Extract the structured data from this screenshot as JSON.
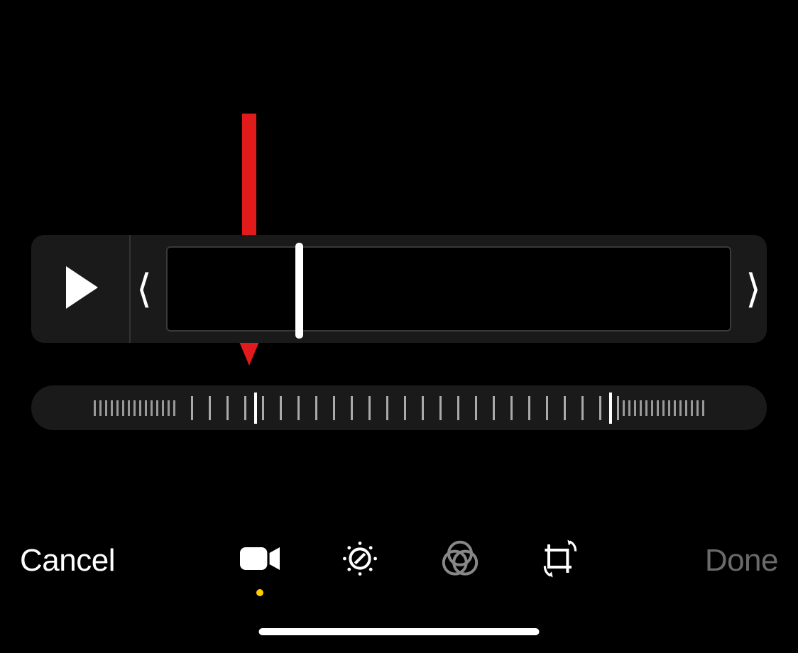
{
  "toolbar": {
    "cancel_label": "Cancel",
    "done_label": "Done"
  },
  "tabs": {
    "video": "video",
    "adjust": "adjust",
    "filters": "filters",
    "crop": "crop",
    "active": "video"
  },
  "icons": {
    "play": "play-icon",
    "video": "video-camera-icon",
    "adjust": "adjust-dial-icon",
    "filters": "filters-circles-icon",
    "crop": "crop-rotate-icon"
  },
  "annotation": {
    "arrow_color": "#e11b1b"
  },
  "colors": {
    "background": "#000000",
    "panel": "#1a1a1a",
    "active_indicator": "#ffcc00",
    "text": "#ffffff",
    "disabled_text": "#6a6a6a"
  }
}
